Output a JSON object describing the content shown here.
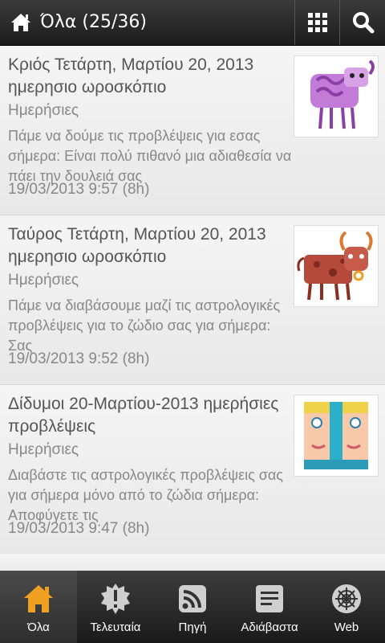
{
  "header": {
    "title": "Όλα (25/36)"
  },
  "items": [
    {
      "title": "Κριός Τετάρτη, Μαρτίου 20, 2013 ημερησιο ωροσκόπιο",
      "category": "Ημερήσιες",
      "description": "Πάμε να δούμε τις προβλέψεις για εσας σήμερα: Είναι πολύ πιθανό μια αδιαθεσία να πάει την δουλειά σας",
      "date": "19/03/2013 9:57 (8h)",
      "thumb_icon": "aries-ram-icon"
    },
    {
      "title": "Ταύρος Τετάρτη, Μαρτίου 20, 2013 ημερησιο ωροσκόπιο",
      "category": "Ημερήσιες",
      "description": "Πάμε να διαβάσουμε μαζί τις αστρολογικές προβλέψεις για το ζώδιο σας για σήμερα: Σας",
      "date": "19/03/2013 9:52 (8h)",
      "thumb_icon": "taurus-bull-icon"
    },
    {
      "title": "Δίδυμοι 20-Μαρτίου-2013 ημερήσιες προβλέψεις",
      "category": "Ημερήσιες",
      "description": "Διαβάστε τις αστρολογικές προβλέψεις σας για σήμερα μόνο από το ζώδια σήμερα: Αποφύγετε τις",
      "date": "19/03/2013 9:47 (8h)",
      "thumb_icon": "gemini-twins-icon"
    }
  ],
  "tabs": [
    {
      "label": "Όλα",
      "icon": "home-icon",
      "active": true
    },
    {
      "label": "Τελευταία",
      "icon": "new-badge-icon",
      "active": false
    },
    {
      "label": "Πηγή",
      "icon": "rss-icon",
      "active": false
    },
    {
      "label": "Αδιάβαστα",
      "icon": "unread-document-icon",
      "active": false
    },
    {
      "label": "Web",
      "icon": "web-globe-icon",
      "active": false
    }
  ],
  "colors": {
    "accent_orange": "#f0a020",
    "topbar": "#2a2a2a",
    "text_gray": "#888888"
  }
}
